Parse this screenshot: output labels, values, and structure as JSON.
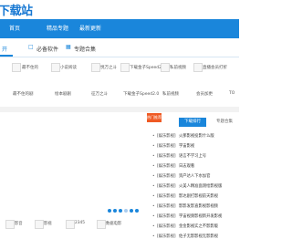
{
  "header": {
    "logo": "下载站"
  },
  "nav": [
    "首页",
    "精品专题",
    "最新更新"
  ],
  "tabs": [
    {
      "label": "开",
      "icon": "",
      "active": true
    },
    {
      "label": "必备软件",
      "icon": "box-icon",
      "active": false
    },
    {
      "label": "专题合集",
      "icon": "grid-icon",
      "active": false
    }
  ],
  "apps_top": [
    "最不住的",
    "小说阅读",
    "悦万之斗",
    "下载金子Speed2.0",
    "私前视频",
    "直播会员打折"
  ],
  "apps_names": [
    "最不住的剧",
    "绘本剧剧",
    "征万之斗",
    "下载金子Speed2.0",
    "私前视频",
    "会员加更",
    "TO"
  ],
  "hot_badge": "热门推荐",
  "right_tabs": [
    "下载排行",
    "专题合集"
  ],
  "list": [
    {
      "cat": "[娱乐影视]",
      "title": "火那影视投影什么版"
    },
    {
      "cat": "[娱乐影视]",
      "title": "宇宙影视"
    },
    {
      "cat": "[娱乐影视]",
      "title": "语言不学习上号"
    },
    {
      "cat": "[娱乐影视]",
      "title": "日志观看"
    },
    {
      "cat": "[娱乐影视]",
      "title": "资产达人下水加官"
    },
    {
      "cat": "[娱乐影视]",
      "title": "火美人精准面测绘影视版"
    },
    {
      "cat": "[娱乐影视]",
      "title": "影达剧打影视前天影视"
    },
    {
      "cat": "[娱乐影视]",
      "title": "影影发影直影视影视频"
    },
    {
      "cat": "[娱乐影视]",
      "title": "宇宙视频影视新开发影视"
    },
    {
      "cat": "[娱乐影视]",
      "title": "金金影视实之不影影版"
    },
    {
      "cat": "[娱乐影视]",
      "title": "佐子无影影视无影影视"
    }
  ],
  "bottom_apps": [
    "影音",
    "影视",
    "2345",
    "数据电影"
  ]
}
